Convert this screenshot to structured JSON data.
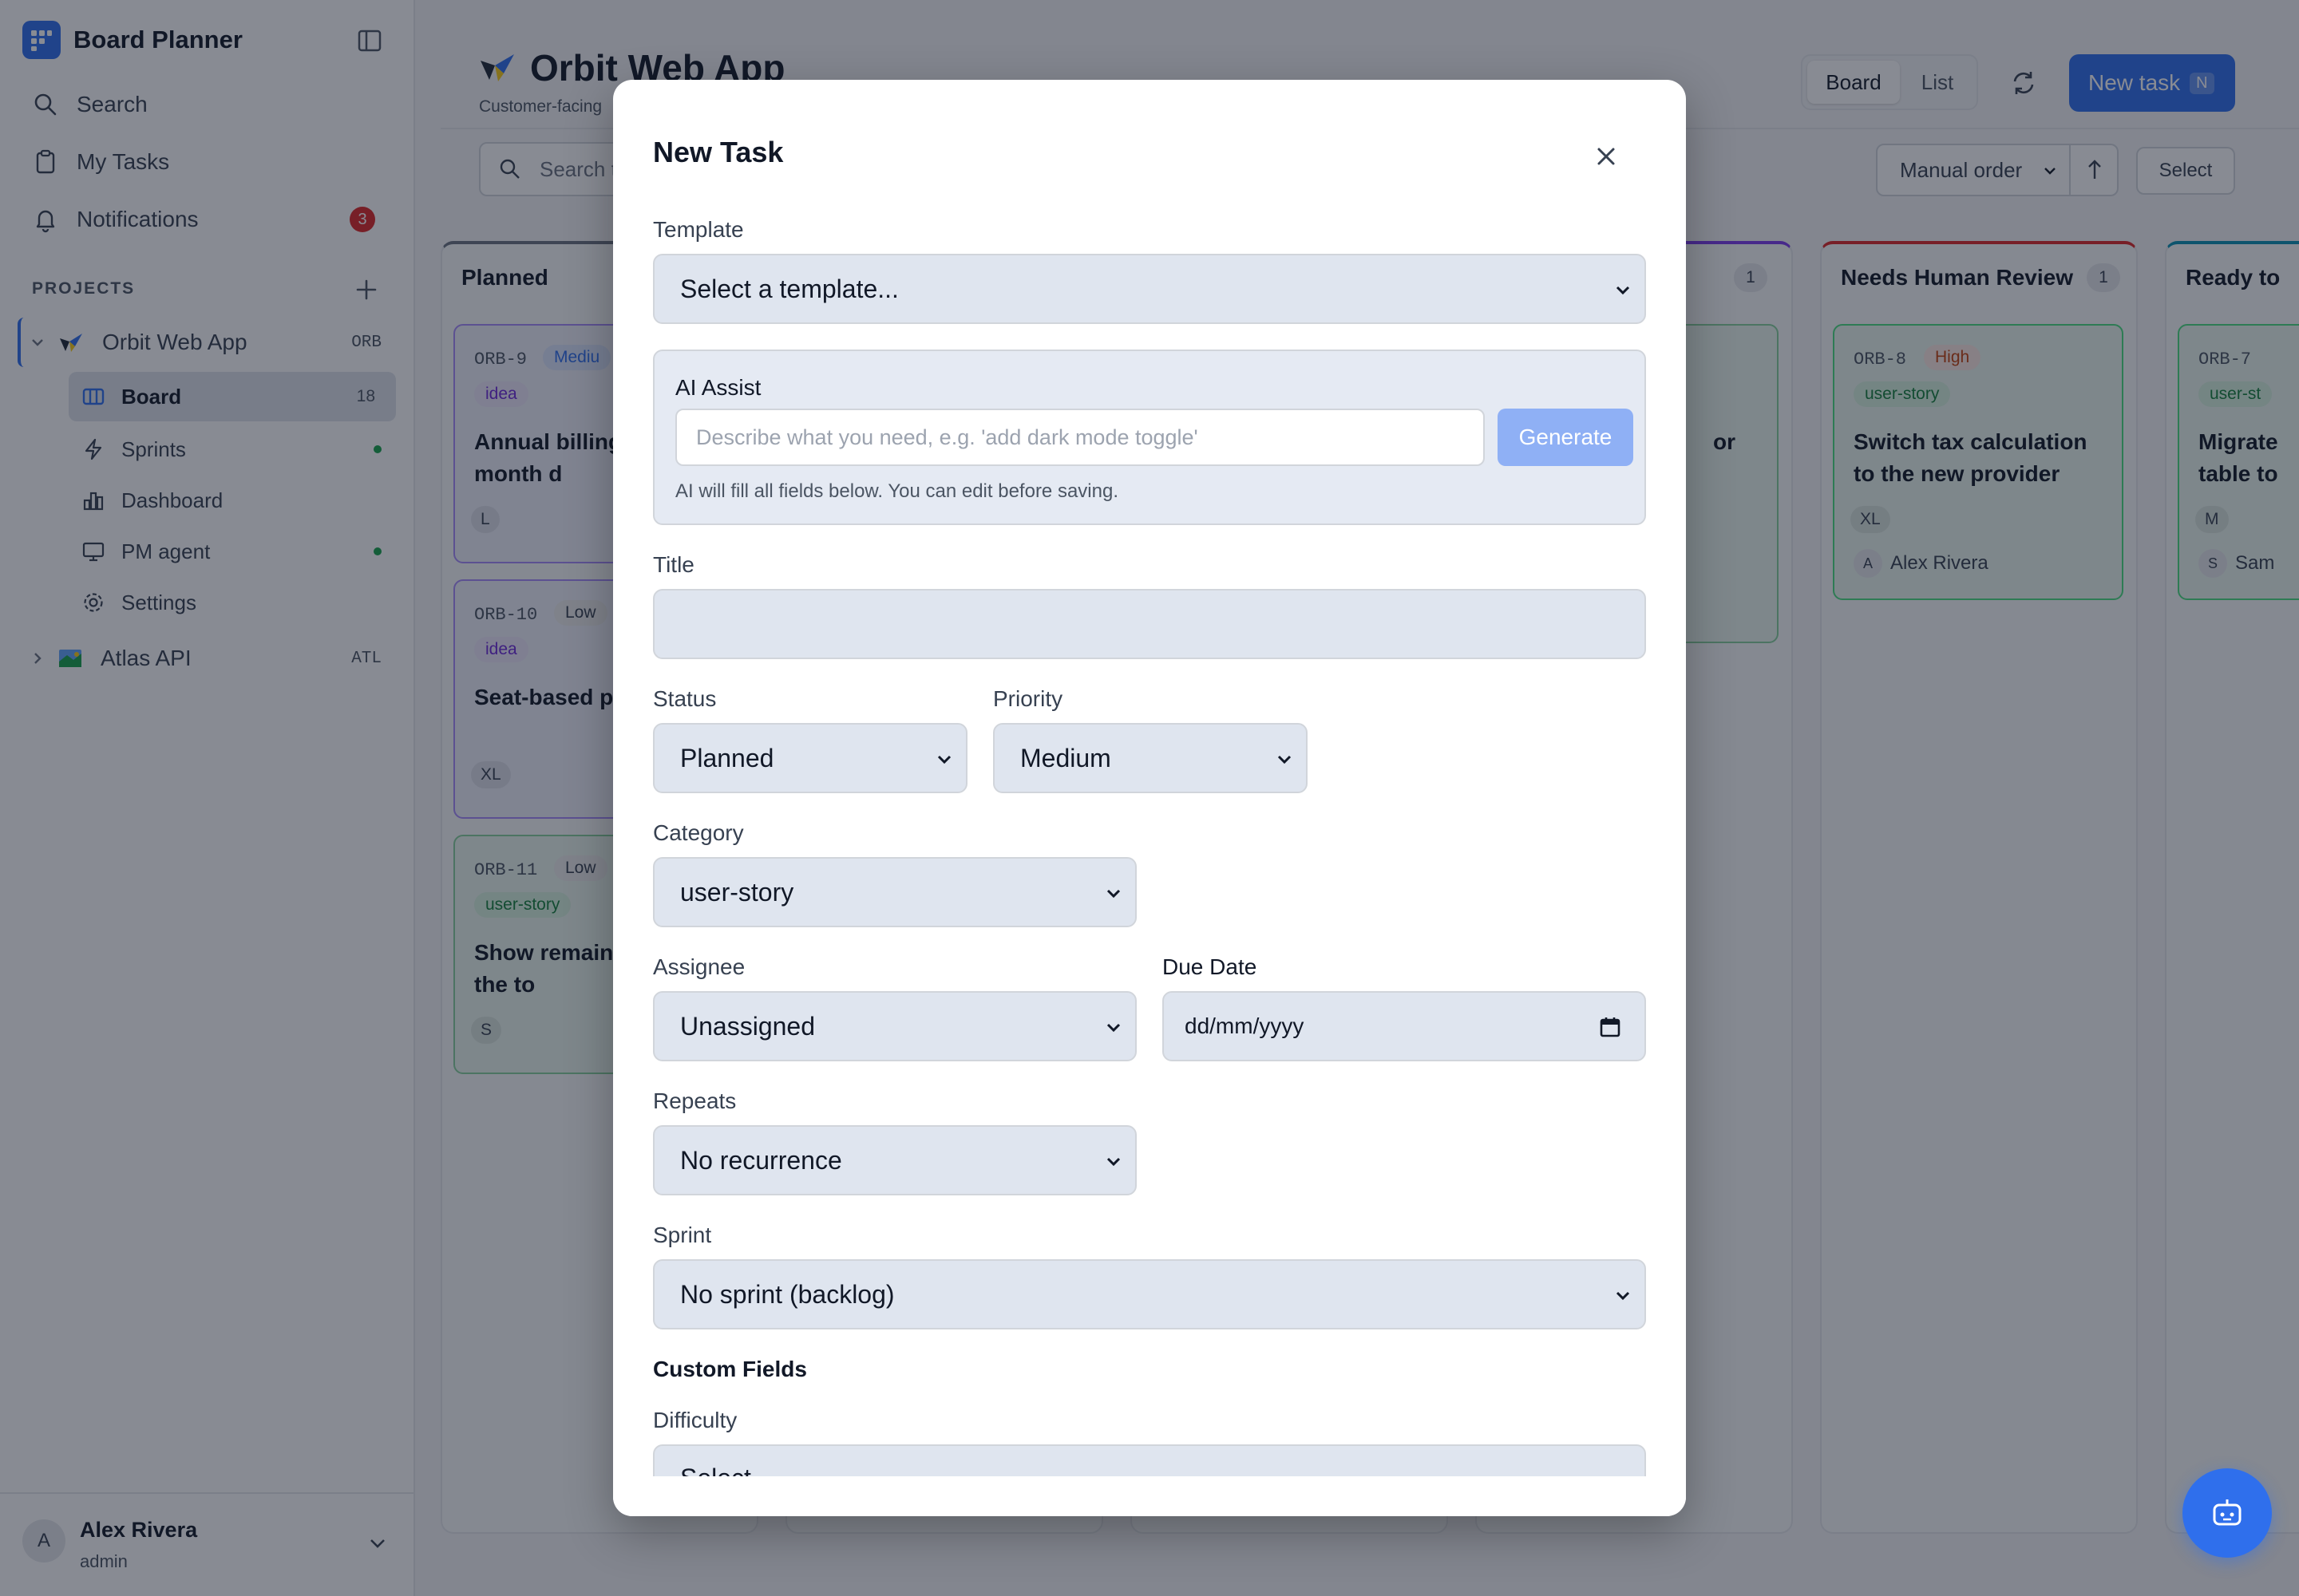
{
  "sidebar": {
    "brand": "Board Planner",
    "nav": {
      "search": "Search",
      "my_tasks": "My Tasks",
      "notifications": "Notifications",
      "notifications_count": "3"
    },
    "projects_title": "PROJECTS",
    "projects": [
      {
        "name": "Orbit Web App",
        "code": "ORB",
        "icon": "bird-icon"
      },
      {
        "name": "Atlas API",
        "code": "ATL",
        "icon": "map-icon"
      }
    ],
    "subnav": {
      "board": "Board",
      "board_count": "18",
      "sprints": "Sprints",
      "dashboard": "Dashboard",
      "pm_agent": "PM agent",
      "settings": "Settings"
    },
    "user": {
      "initial": "A",
      "name": "Alex Rivera",
      "role": "admin"
    }
  },
  "header": {
    "title": "Orbit Web App",
    "subtitle": "Customer-facing",
    "view_board": "Board",
    "view_list": "List",
    "new_task": "New task",
    "new_task_shortcut": "N",
    "search_placeholder": "Search t",
    "sort": "Manual order",
    "select": "Select"
  },
  "columns": [
    {
      "title": "Planned",
      "count": "",
      "accent": "#6b7280"
    },
    {
      "title": "",
      "count": "1",
      "accent": "#7c3aed"
    },
    {
      "title": "Needs Human Review",
      "count": "1",
      "accent": "#dc2626"
    },
    {
      "title": "Ready to",
      "count": "",
      "accent": "#0891b2"
    }
  ],
  "cards": {
    "orb9": {
      "id": "ORB-9",
      "priority": "Mediu",
      "tag": "idea",
      "title": "Annual billing two-month d",
      "size": "L"
    },
    "orb10": {
      "id": "ORB-10",
      "priority": "Low",
      "tag": "idea",
      "title": "Seat-based p teams",
      "size": "XL"
    },
    "orb11": {
      "id": "ORB-11",
      "priority": "Low",
      "tag": "user-story",
      "title": "Show remain days in the to",
      "size": "S"
    },
    "partial": {
      "title": "or"
    },
    "orb8": {
      "id": "ORB-8",
      "priority": "High",
      "tag": "user-story",
      "title": "Switch tax calculation to the new provider",
      "size": "XL",
      "assignee_initial": "A",
      "assignee": "Alex Rivera"
    },
    "orb7": {
      "id": "ORB-7",
      "tag": "user-st",
      "title": "Migrate table to",
      "size": "M",
      "assignee_initial": "S",
      "assignee": "Sam"
    }
  },
  "modal": {
    "title": "New Task",
    "template_label": "Template",
    "template_value": "Select a template...",
    "ai_label": "AI Assist",
    "ai_placeholder": "Describe what you need, e.g. 'add dark mode toggle'",
    "ai_button": "Generate",
    "ai_note": "AI will fill all fields below. You can edit before saving.",
    "title_label": "Title",
    "title_value": "",
    "status_label": "Status",
    "status_value": "Planned",
    "priority_label": "Priority",
    "priority_value": "Medium",
    "category_label": "Category",
    "category_value": "user-story",
    "assignee_label": "Assignee",
    "assignee_value": "Unassigned",
    "due_label": "Due Date",
    "due_value": "dd/mm/yyyy",
    "repeats_label": "Repeats",
    "repeats_value": "No recurrence",
    "sprint_label": "Sprint",
    "sprint_value": "No sprint (backlog)",
    "custom_fields_label": "Custom Fields",
    "difficulty_label": "Difficulty",
    "difficulty_value": "Select..."
  },
  "colors": {
    "accent": "#2f6fec",
    "overlay": "rgba(17,24,39,0.5)",
    "danger": "#dc2626",
    "success": "#16a34a"
  }
}
